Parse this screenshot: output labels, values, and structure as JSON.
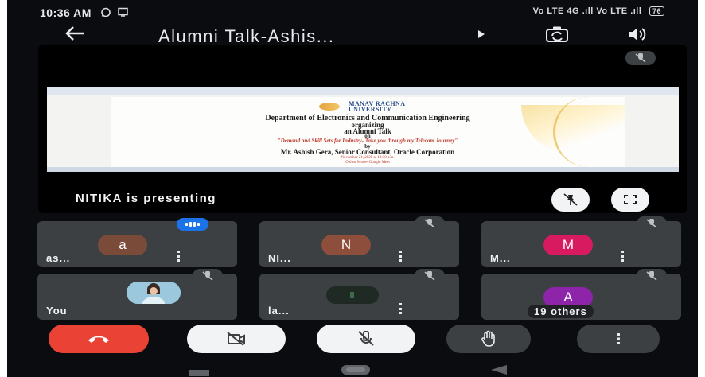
{
  "status_bar": {
    "time": "10:36 AM",
    "icons_left": [
      "whatsapp-icon",
      "screen-cast-icon"
    ],
    "network": "Vo LTE 4G .ıll Vo LTE .ıll",
    "battery": "76"
  },
  "header": {
    "title": "Alumni Talk-Ashis...",
    "icons": [
      "back-arrow-icon",
      "expand-caret-icon",
      "switch-camera-icon",
      "speaker-icon"
    ]
  },
  "stage": {
    "presenting_label": "NITIKA is presenting",
    "slide": {
      "university_line1": "MANAV RACHNA",
      "university_line2": "UNIVERSITY",
      "lines": [
        "Department of Electronics and Communication Engineering",
        "organizing",
        "an Alumni Talk",
        "on",
        "\"Demand and Skill Sets for Industry- Take you through my Telecom Journey\"",
        "by",
        "Mr. Ashish Gera, Senior Consultant, Oracle Corporation",
        "November 21, 2020 at 10:30 a.m.",
        "Online Mode- Google Meet"
      ],
      "colors": {
        "heading": "#1b1b1b",
        "topic": "#c0392b",
        "date": "#c0392b"
      }
    }
  },
  "participants": [
    {
      "name": "as...",
      "initial": "a",
      "avatar_color": "#7b4b3a",
      "speaking": true,
      "muted": false
    },
    {
      "name": "NI...",
      "initial": "N",
      "avatar_color": "#8d4f3c",
      "speaking": false,
      "muted": true
    },
    {
      "name": "M...",
      "initial": "M",
      "avatar_color": "#d81b60",
      "speaking": false,
      "muted": true
    },
    {
      "name": "You",
      "initial": "",
      "avatar_color": "#6fa9c9",
      "speaking": false,
      "muted": true,
      "photo": true
    },
    {
      "name": "la...",
      "initial": "",
      "avatar_color": "#1f2a24",
      "speaking": false,
      "muted": true,
      "video_dark": true
    },
    {
      "name": "19 others",
      "initial": "A",
      "avatar_color": "#8e24aa",
      "speaking": false,
      "muted": true
    }
  ],
  "controls": {
    "buttons": [
      "end-call",
      "camera-off",
      "mic-off",
      "raise-hand",
      "more-options"
    ],
    "end_call_color": "#ea4335"
  },
  "nav_bar": {
    "icons": [
      "recents-icon",
      "home-icon",
      "back-icon"
    ]
  }
}
